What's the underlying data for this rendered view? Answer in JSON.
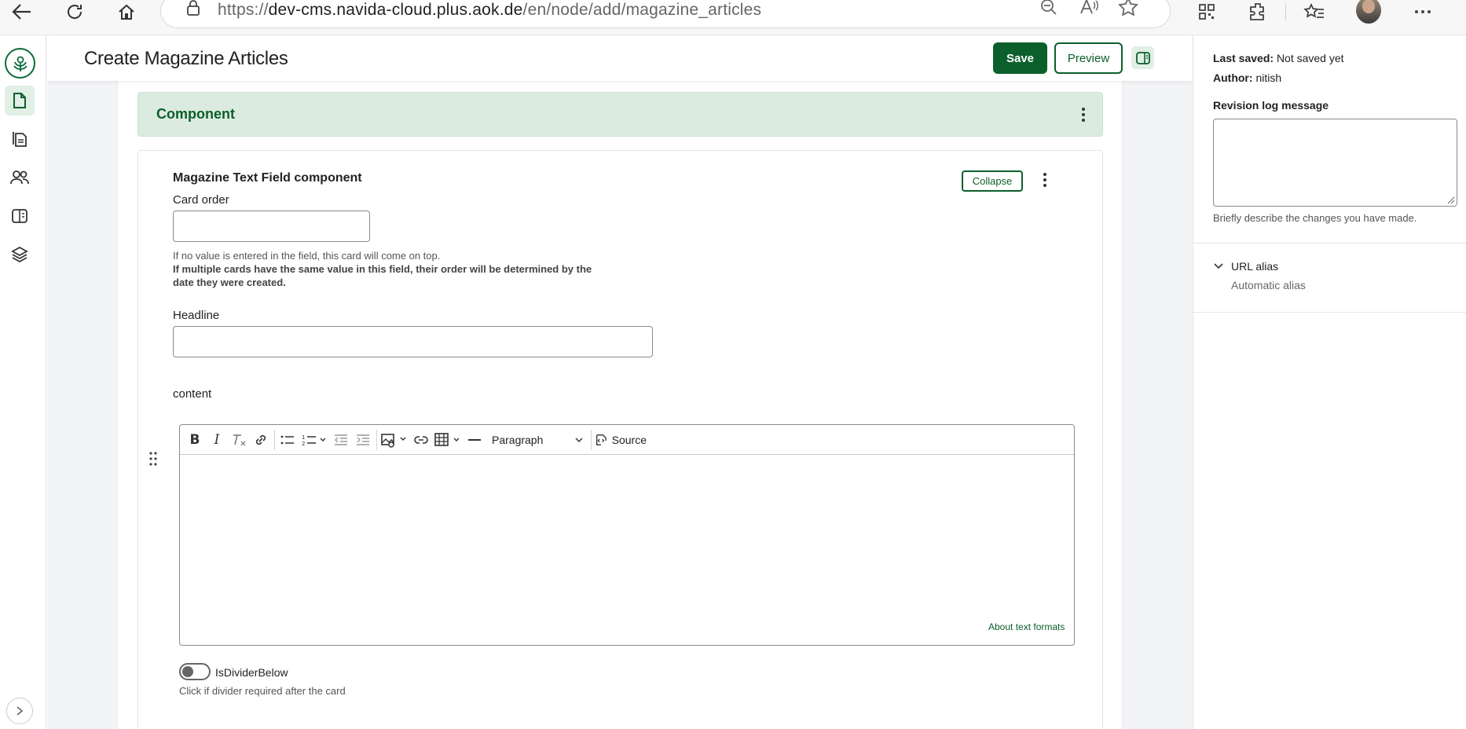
{
  "browser": {
    "url_prefix": "https://",
    "url_host": "dev-cms.navida-cloud.plus.aok.de",
    "url_path": "/en/node/add/magazine_articles"
  },
  "header": {
    "title": "Create Magazine Articles",
    "save_label": "Save",
    "preview_label": "Preview"
  },
  "component": {
    "title": "Component",
    "card_title": "Magazine Text Field component",
    "collapse_label": "Collapse",
    "card_order_label": "Card order",
    "card_order_value": "",
    "card_order_help": "If no value is entered in the field, this card will come on top.",
    "card_order_help_bold": "If multiple cards have the same value in this field, their order will be determined by the date they were created.",
    "headline_label": "Headline",
    "headline_value": "",
    "content_label": "content",
    "format_select": "Paragraph",
    "source_label": "Source",
    "about_formats": "About text formats",
    "divider_label": "IsDividerBelow",
    "divider_help": "Click if divider required after the card"
  },
  "sidebar": {
    "last_saved_label": "Last saved:",
    "last_saved_value": "Not saved yet",
    "author_label": "Author:",
    "author_value": "nitish",
    "revision_label": "Revision log message",
    "revision_help": "Briefly describe the changes you have made.",
    "url_alias_label": "URL alias",
    "url_alias_value": "Automatic alias"
  },
  "colors": {
    "brand_green": "#0b5f2b",
    "component_bg": "#dcebdf"
  }
}
